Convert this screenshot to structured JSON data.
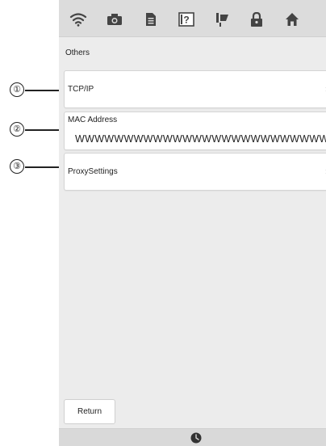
{
  "topbar": {
    "icons": [
      "wifi-icon",
      "camera-icon",
      "document-icon",
      "help-icon",
      "sewing-icon",
      "lock-icon",
      "home-icon"
    ]
  },
  "section": {
    "title": "Others"
  },
  "items": {
    "tcp": {
      "label": "TCP/IP"
    },
    "mac": {
      "label": "MAC Address",
      "value": "WWWWWWWWWWWWWWWWWWWWWWWWWWWWWWWWWW"
    },
    "proxy": {
      "label": "ProxySettings"
    }
  },
  "footer": {
    "return_label": "Return"
  },
  "callouts": {
    "one": "①",
    "two": "②",
    "three": "③"
  },
  "colors": {
    "screen_bg": "#ececec",
    "panel_bg": "#ffffff",
    "bar_bg": "#dcdcdc"
  }
}
